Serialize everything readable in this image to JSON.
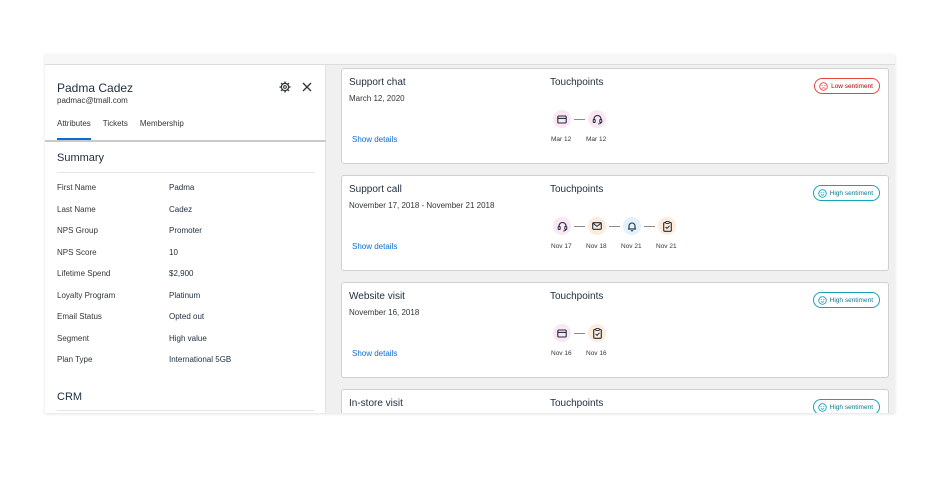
{
  "profile": {
    "name": "Padma Cadez",
    "email": "padmac@tmall.com",
    "tabs": [
      "Attributes",
      "Tickets",
      "Membership"
    ],
    "active_tab": "Attributes"
  },
  "summary": {
    "title": "Summary",
    "rows": [
      {
        "label": "First Name",
        "value": "Padma"
      },
      {
        "label": "Last Name",
        "value": "Cadez"
      },
      {
        "label": "NPS Group",
        "value": "Promoter"
      },
      {
        "label": "NPS Score",
        "value": "10"
      },
      {
        "label": "Lifetime Spend",
        "value": "$2,900"
      },
      {
        "label": "Loyalty Program",
        "value": "Platinum"
      },
      {
        "label": "Email Status",
        "value": "Opted out"
      },
      {
        "label": "Segment",
        "value": "High value"
      },
      {
        "label": "Plan Type",
        "value": "International 5GB"
      }
    ]
  },
  "crm": {
    "title": "CRM"
  },
  "interactions": [
    {
      "title": "Support chat",
      "date": "March 12, 2020",
      "link": "Show details",
      "touchpoints_label": "Touchpoints",
      "sentiment": "Low sentiment",
      "touchpoints": [
        {
          "icon": "wallet-icon",
          "date": "Mar 12"
        },
        {
          "icon": "headset-icon",
          "date": "Mar 12"
        }
      ]
    },
    {
      "title": "Support call",
      "date": "November 17, 2018 - November 21 2018",
      "link": "Show details",
      "touchpoints_label": "Touchpoints",
      "sentiment": "High sentiment",
      "touchpoints": [
        {
          "icon": "headset-icon",
          "date": "Nov 17"
        },
        {
          "icon": "envelope-icon",
          "date": "Nov 18"
        },
        {
          "icon": "bell-icon",
          "date": "Nov 21"
        },
        {
          "icon": "clipboard-check-icon",
          "date": "Nov 21"
        }
      ]
    },
    {
      "title": "Website visit",
      "date": "November 16, 2018",
      "link": "Show details",
      "touchpoints_label": "Touchpoints",
      "sentiment": "High sentiment",
      "touchpoints": [
        {
          "icon": "wallet-icon",
          "date": "Nov 16"
        },
        {
          "icon": "clipboard-check-icon",
          "date": "Nov 16"
        }
      ]
    },
    {
      "title": "In-store visit",
      "touchpoints_label": "Touchpoints",
      "sentiment": "High sentiment"
    }
  ],
  "colors": {
    "accent": "#0a6ed1",
    "pink": "#fbe6f3",
    "orange": "#fdebdc",
    "blue": "#e1f0fb",
    "low": "#e54642",
    "high": "#17a2b8"
  }
}
